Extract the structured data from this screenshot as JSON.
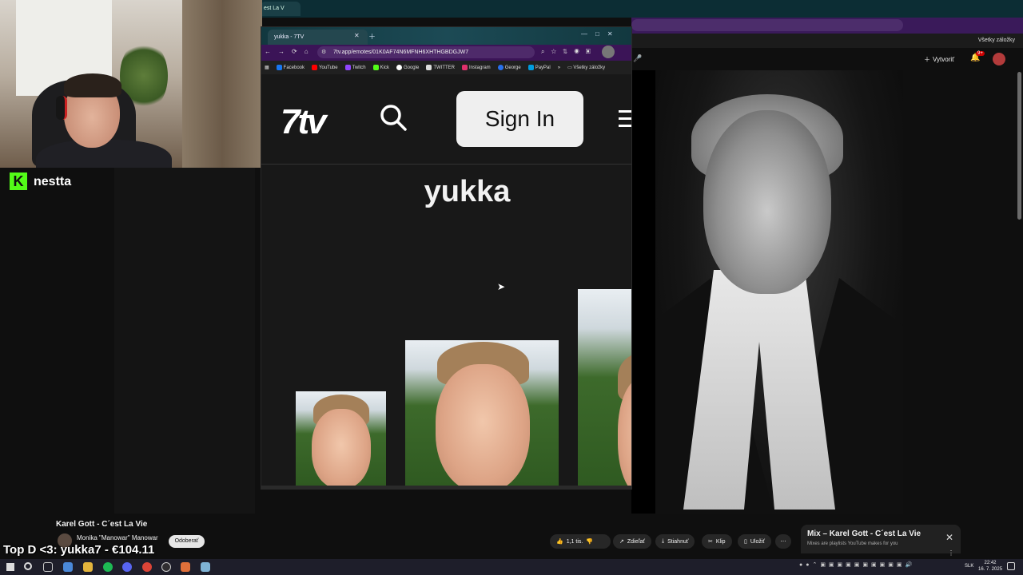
{
  "background_browser": {
    "tab_title": "est La V",
    "bookmarks_folder": "Všetky záložky"
  },
  "youtube": {
    "create_label": "Vytvoriť",
    "notif_count": "9+",
    "video_title": "Karel Gott - C´est La Vie",
    "channel_name": "Monika \"Manowar\" Manowar",
    "unsubscribe_label": "Odoberať",
    "actions": {
      "like": "1,1 tis.",
      "share": "Zdieľať",
      "download": "Stiahnuť",
      "clip": "Klip",
      "save": "Uložiť"
    },
    "mix": {
      "title": "Mix – Karel Gott - C´est La Vie",
      "subtitle": "Mixes are playlists YouTube makes for you"
    }
  },
  "stream": {
    "platform": "kick",
    "streamer_name": "nestta",
    "donation_text": "Top D <3: yukka7 - €104.11"
  },
  "popup_browser": {
    "tab_title": "yukka - 7TV",
    "url": "7tv.app/emotes/01K0AF74N6MFNH6XHTHGBDGJW7",
    "bookmarks": [
      {
        "label": "Facebook",
        "color": "#1877f2"
      },
      {
        "label": "YouTube",
        "color": "#ff0000"
      },
      {
        "label": "Twitch",
        "color": "#9146ff"
      },
      {
        "label": "Kick",
        "color": "#53fc18"
      },
      {
        "label": "Google",
        "color": "#ffffff"
      },
      {
        "label": "TWITTER",
        "color": "#dddddd"
      },
      {
        "label": "Instagram",
        "color": "#e1306c"
      },
      {
        "label": "George",
        "color": "#2870ed"
      },
      {
        "label": "PayPal",
        "color": "#009cde"
      }
    ],
    "bookmarks_folder": "Všetky záložky",
    "site": {
      "logo": "7tv",
      "signin_label": "Sign In",
      "emote_name": "yukka"
    }
  },
  "taskbar": {
    "language": "SLK",
    "time": "22:42",
    "date": "16. 7. 2025"
  },
  "colors": {
    "kick_green": "#53fc18",
    "youtube_red": "#cc0000",
    "popup_toolbar": "#3b1457"
  }
}
